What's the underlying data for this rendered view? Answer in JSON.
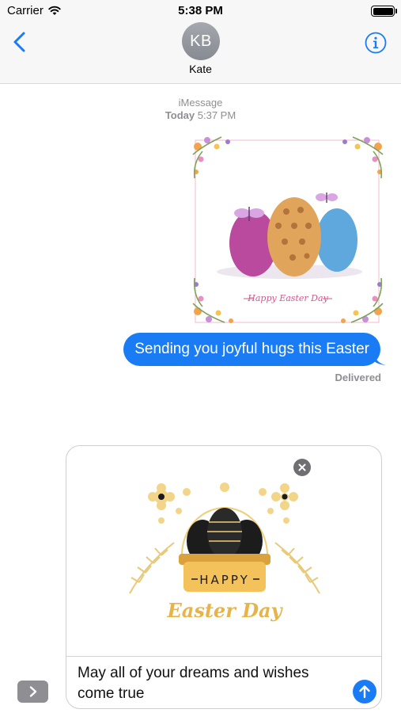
{
  "status_bar": {
    "carrier": "Carrier",
    "time": "5:38 PM"
  },
  "header": {
    "avatar_initials": "KB",
    "contact_name": "Kate"
  },
  "conversation": {
    "service": "iMessage",
    "timestamp_day": "Today",
    "timestamp_time": "5:37 PM",
    "sticker_caption": "Happy Easter Day",
    "message_text": "Sending you joyful hugs this Easter",
    "delivery_status": "Delivered"
  },
  "compose": {
    "sticker_banner": "HAPPY",
    "sticker_script": "Easter Day",
    "draft_text": "May all of your dreams and wishes come true"
  },
  "colors": {
    "accent": "#1a7cf5",
    "meta_gray": "#8e8e93",
    "gold": "#e8b447"
  }
}
